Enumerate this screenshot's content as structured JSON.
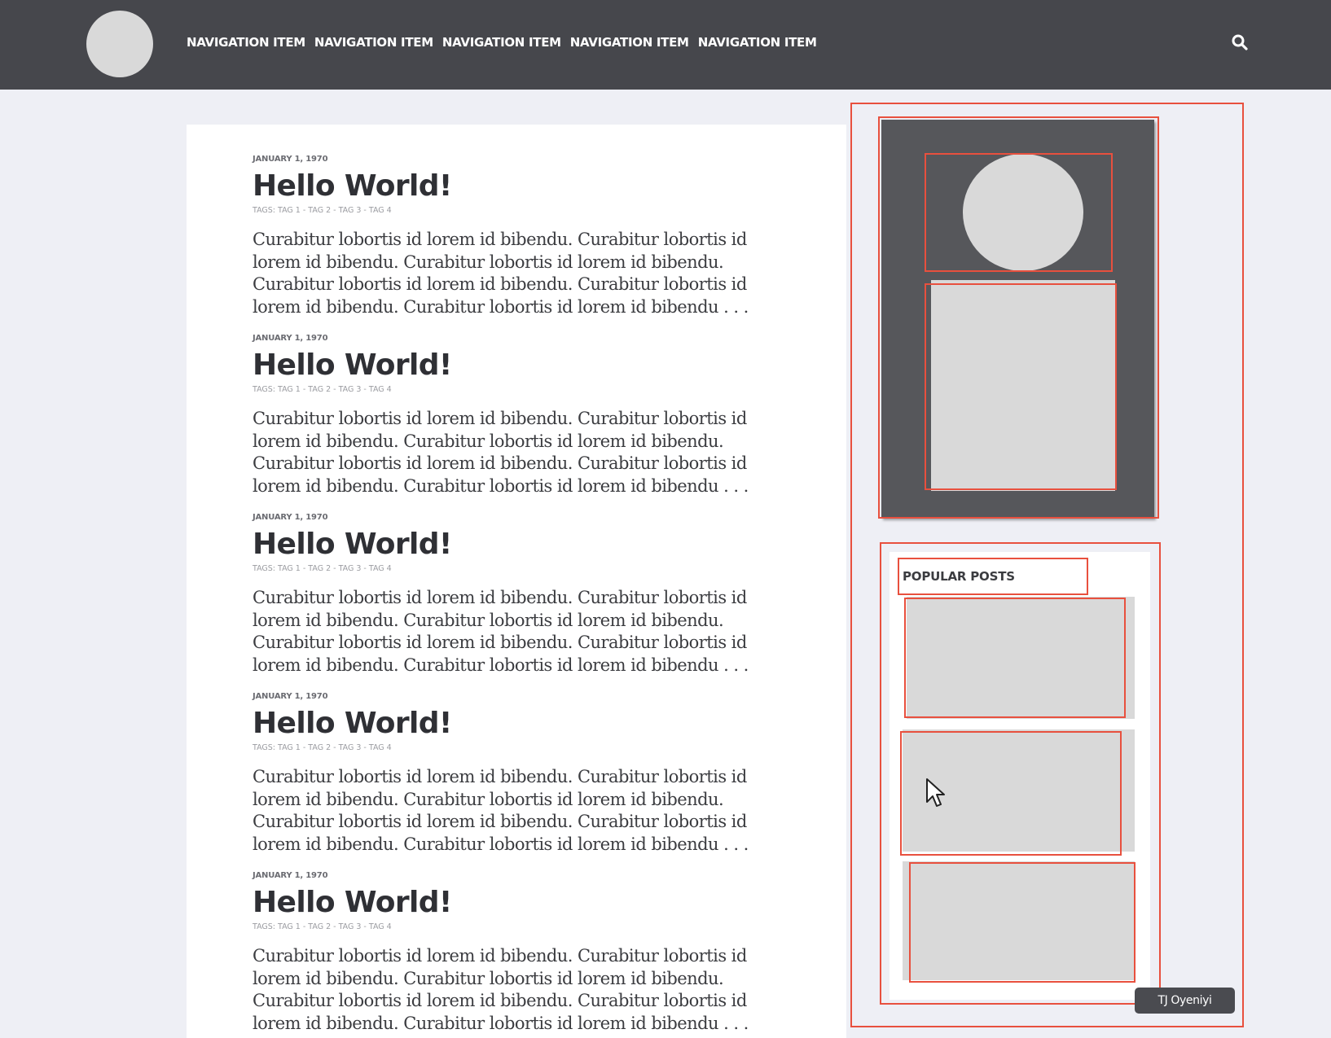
{
  "nav": {
    "items": [
      "NAVIGATION ITEM",
      "NAVIGATION ITEM",
      "NAVIGATION ITEM",
      "NAVIGATION ITEM",
      "NAVIGATION ITEM"
    ],
    "search_icon": "search-icon"
  },
  "posts": [
    {
      "date": "JANUARY 1, 1970",
      "title": "Hello World!",
      "tags": "TAGS: TAG 1 - TAG 2 - TAG 3 - TAG 4",
      "excerpt": "Curabitur lobortis id lorem id bibendu. Curabitur lobortis id lorem id bibendu. Curabitur lobortis id lorem id bibendu. Curabitur lobortis id lorem id bibendu. Curabitur lobortis id lorem id bibendu. Curabitur lobortis id lorem id bibendu . . ."
    },
    {
      "date": "JANUARY 1, 1970",
      "title": "Hello World!",
      "tags": "TAGS: TAG 1 - TAG 2 - TAG 3 - TAG 4",
      "excerpt": "Curabitur lobortis id lorem id bibendu. Curabitur lobortis id lorem id bibendu. Curabitur lobortis id lorem id bibendu. Curabitur lobortis id lorem id bibendu. Curabitur lobortis id lorem id bibendu. Curabitur lobortis id lorem id bibendu . . ."
    },
    {
      "date": "JANUARY 1, 1970",
      "title": "Hello World!",
      "tags": "TAGS: TAG 1 - TAG 2 - TAG 3 - TAG 4",
      "excerpt": "Curabitur lobortis id lorem id bibendu. Curabitur lobortis id lorem id bibendu. Curabitur lobortis id lorem id bibendu. Curabitur lobortis id lorem id bibendu. Curabitur lobortis id lorem id bibendu. Curabitur lobortis id lorem id bibendu . . ."
    },
    {
      "date": "JANUARY 1, 1970",
      "title": "Hello World!",
      "tags": "TAGS: TAG 1 - TAG 2 - TAG 3 - TAG 4",
      "excerpt": "Curabitur lobortis id lorem id bibendu. Curabitur lobortis id lorem id bibendu. Curabitur lobortis id lorem id bibendu. Curabitur lobortis id lorem id bibendu. Curabitur lobortis id lorem id bibendu. Curabitur lobortis id lorem id bibendu . . ."
    },
    {
      "date": "JANUARY 1, 1970",
      "title": "Hello World!",
      "tags": "TAGS: TAG 1 - TAG 2 - TAG 3 - TAG 4",
      "excerpt": "Curabitur lobortis id lorem id bibendu. Curabitur lobortis id lorem id bibendu. Curabitur lobortis id lorem id bibendu. Curabitur lobortis id lorem id bibendu. Curabitur lobortis id lorem id bibendu. Curabitur lobortis id lorem id bibendu . . ."
    }
  ],
  "sidebar": {
    "popular_title": "POPULAR POSTS"
  },
  "author_badge": "TJ Oyeniyi",
  "colors": {
    "nav_bg": "#46474c",
    "page_bg": "#eeeff5",
    "placeholder": "#d9d9d9",
    "outline": "#e8503e"
  }
}
